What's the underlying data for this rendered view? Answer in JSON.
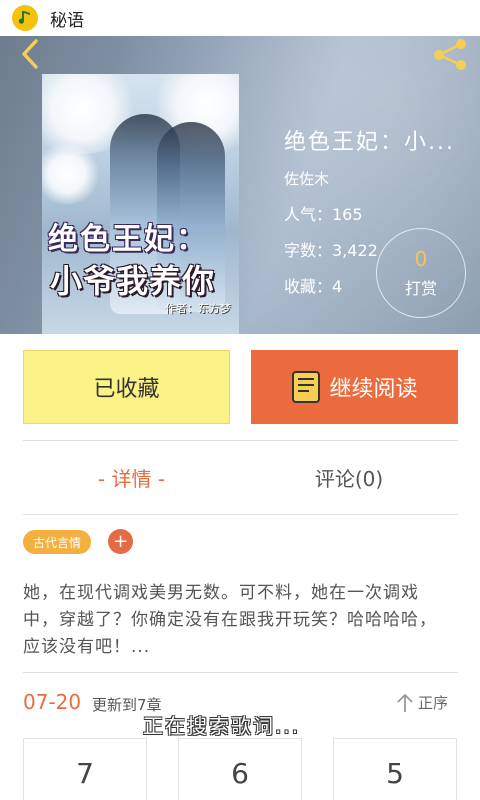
{
  "statusbar": {
    "app_name": "秘语",
    "app_icon": "music-note-icon"
  },
  "hero": {
    "back_icon": "chevron-left-icon",
    "share_icon": "share-icon",
    "cover": {
      "title_line1": "绝色王妃：",
      "title_line2": "小爷我养你",
      "author_tag": "作者：东方梦"
    },
    "title": "绝色王妃：小...",
    "author": "佐佐木",
    "popularity": "人气：165",
    "word_count": "字数：3,422",
    "favorites": "收藏：4",
    "tip": {
      "count": "0",
      "label": "打赏"
    }
  },
  "actions": {
    "collected_label": "已收藏",
    "read_label": "继续阅读",
    "read_icon": "book-icon"
  },
  "tabs": {
    "detail": "- 详情 -",
    "comments": "评论(0)"
  },
  "tags": {
    "genre": "古代言情",
    "add": "+"
  },
  "description": "她，在现代调戏美男无数。可不料，她在一次调戏中，穿越了？你确定没有在跟我开玩笑？哈哈哈哈，应该没有吧！...",
  "update": {
    "date": "07-20",
    "text": "更新到7章",
    "sort_label": "正序",
    "sort_icon": "arrow-up-icon"
  },
  "toast": "正在搜索歌词...",
  "chapters": [
    "7",
    "6",
    "5"
  ],
  "colors": {
    "accent": "#ec6b3e",
    "collected_bg": "#fbf285",
    "genre_tag": "#f3b03f",
    "tip_count": "#f5c64a"
  }
}
